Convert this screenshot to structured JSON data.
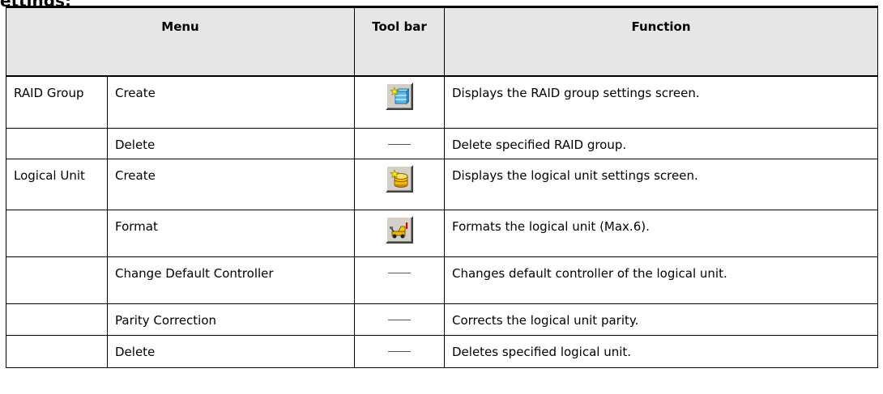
{
  "heading": "ettings:",
  "table": {
    "headers": {
      "menu": "Menu",
      "toolbar": "Tool bar",
      "function": "Function"
    },
    "rows": [
      {
        "group": "RAID Group",
        "item": "Create",
        "toolbar_icon": "raid-group-create-icon",
        "function": "Displays the RAID group settings screen."
      },
      {
        "group": "",
        "item": "Delete",
        "toolbar_icon": "none",
        "function": "Delete specified RAID group."
      },
      {
        "group": "Logical Unit",
        "item": "Create",
        "toolbar_icon": "logical-unit-create-icon",
        "function": "Displays the logical unit settings screen."
      },
      {
        "group": "",
        "item": "Format",
        "toolbar_icon": "format-icon",
        "function": "Formats the logical unit (Max.6)."
      },
      {
        "group": "",
        "item": "Change Default Controller",
        "toolbar_icon": "none",
        "function": "Changes default controller of the logical unit."
      },
      {
        "group": "",
        "item": "Parity Correction",
        "toolbar_icon": "none",
        "function": "Corrects the logical unit parity."
      },
      {
        "group": "",
        "item": "Delete",
        "toolbar_icon": "none",
        "function": "Deletes specified logical unit."
      }
    ]
  }
}
